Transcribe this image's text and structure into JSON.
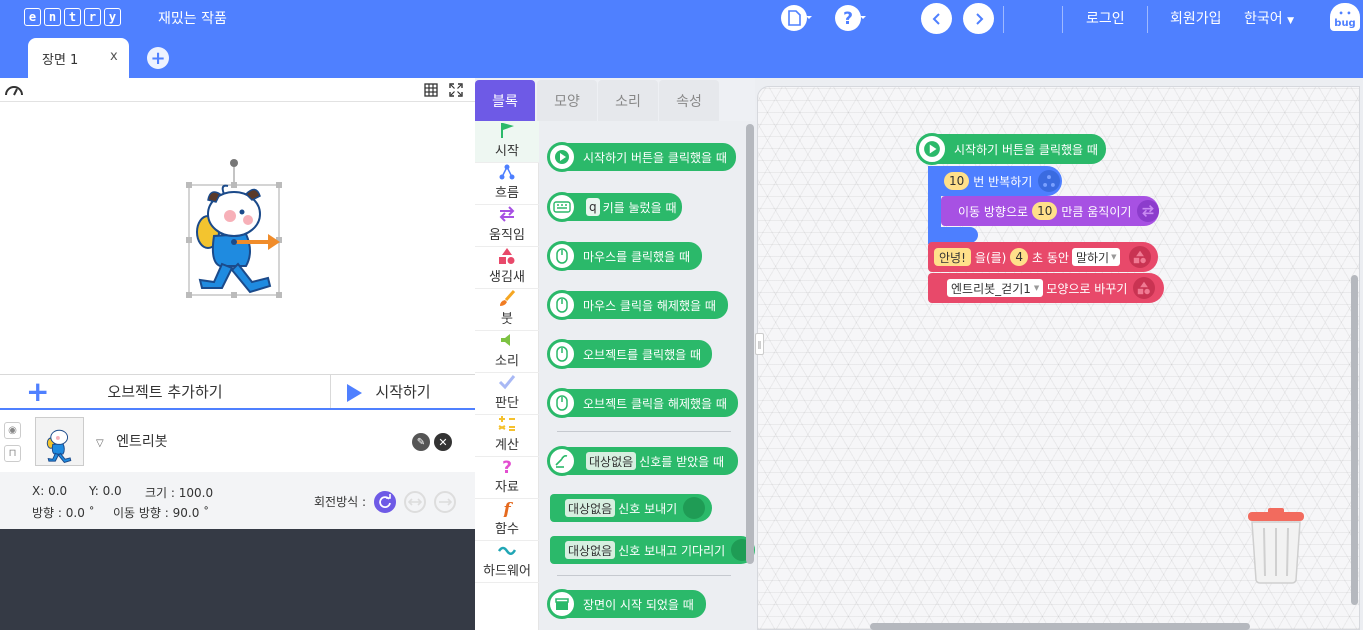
{
  "topbar": {
    "logo_letters": [
      "e",
      "n",
      "t",
      "r",
      "y"
    ],
    "project_title": "재밌는 작품",
    "login": "로그인",
    "signup": "회원가입",
    "language": "한국어",
    "bug_label": "bug",
    "scene_tab": "장면 1",
    "scene_close": "x",
    "add_scene": "+"
  },
  "stage_actions": {
    "add_object": "오브젝트 추가하기",
    "start": "시작하기"
  },
  "object": {
    "name": "엔트리봇"
  },
  "props": {
    "x": "X: 0.0",
    "y": "Y: 0.0",
    "size": "크기 : 100.0",
    "direction": "방향 : 0.0 ˚",
    "move_direction": "이동 방향 : 90.0 ˚",
    "rotation_label": "회전방식 :"
  },
  "tabs": [
    "블록",
    "모양",
    "소리",
    "속성"
  ],
  "categories": [
    "시작",
    "흐름",
    "움직임",
    "생김새",
    "붓",
    "소리",
    "판단",
    "계산",
    "자료",
    "함수",
    "하드웨어"
  ],
  "palette": {
    "b1": "시작하기 버튼을 클릭했을 때",
    "b2_key": "q",
    "b2": "키를 눌렀을 때",
    "b3": "마우스를 클릭했을 때",
    "b4": "마우스 클릭을 해제했을 때",
    "b5": "오브젝트를 클릭했을 때",
    "b6": "오브젝트 클릭을 해제했을 때",
    "b7_target": "대상없음",
    "b7": "신호를 받았을 때",
    "b8_target": "대상없음",
    "b8": "신호 보내기",
    "b9_target": "대상없음",
    "b9": "신호 보내고 기다리기",
    "b10": "장면이 시작 되었을 때"
  },
  "script": {
    "hat": "시작하기 버튼을 클릭했을 때",
    "repeat_count": "10",
    "repeat_label": "번 반복하기",
    "move_prefix": "이동 방향으로",
    "move_value": "10",
    "move_suffix": "만큼 움직이기",
    "say_text": "안녕!",
    "say_mid1": "을(를)",
    "say_secs": "4",
    "say_mid2": "초 동안",
    "say_mode": "말하기",
    "shape_name": "엔트리봇_걷기1",
    "shape_suffix": "모양으로 바꾸기"
  },
  "colors": {
    "brand_blue": "#4f80ff",
    "start_green": "#2bb96a",
    "flow_blue": "#4d7fff",
    "move_purple": "#a751e3",
    "looks_red": "#e8496a",
    "tab_active": "#6e5ae6"
  }
}
